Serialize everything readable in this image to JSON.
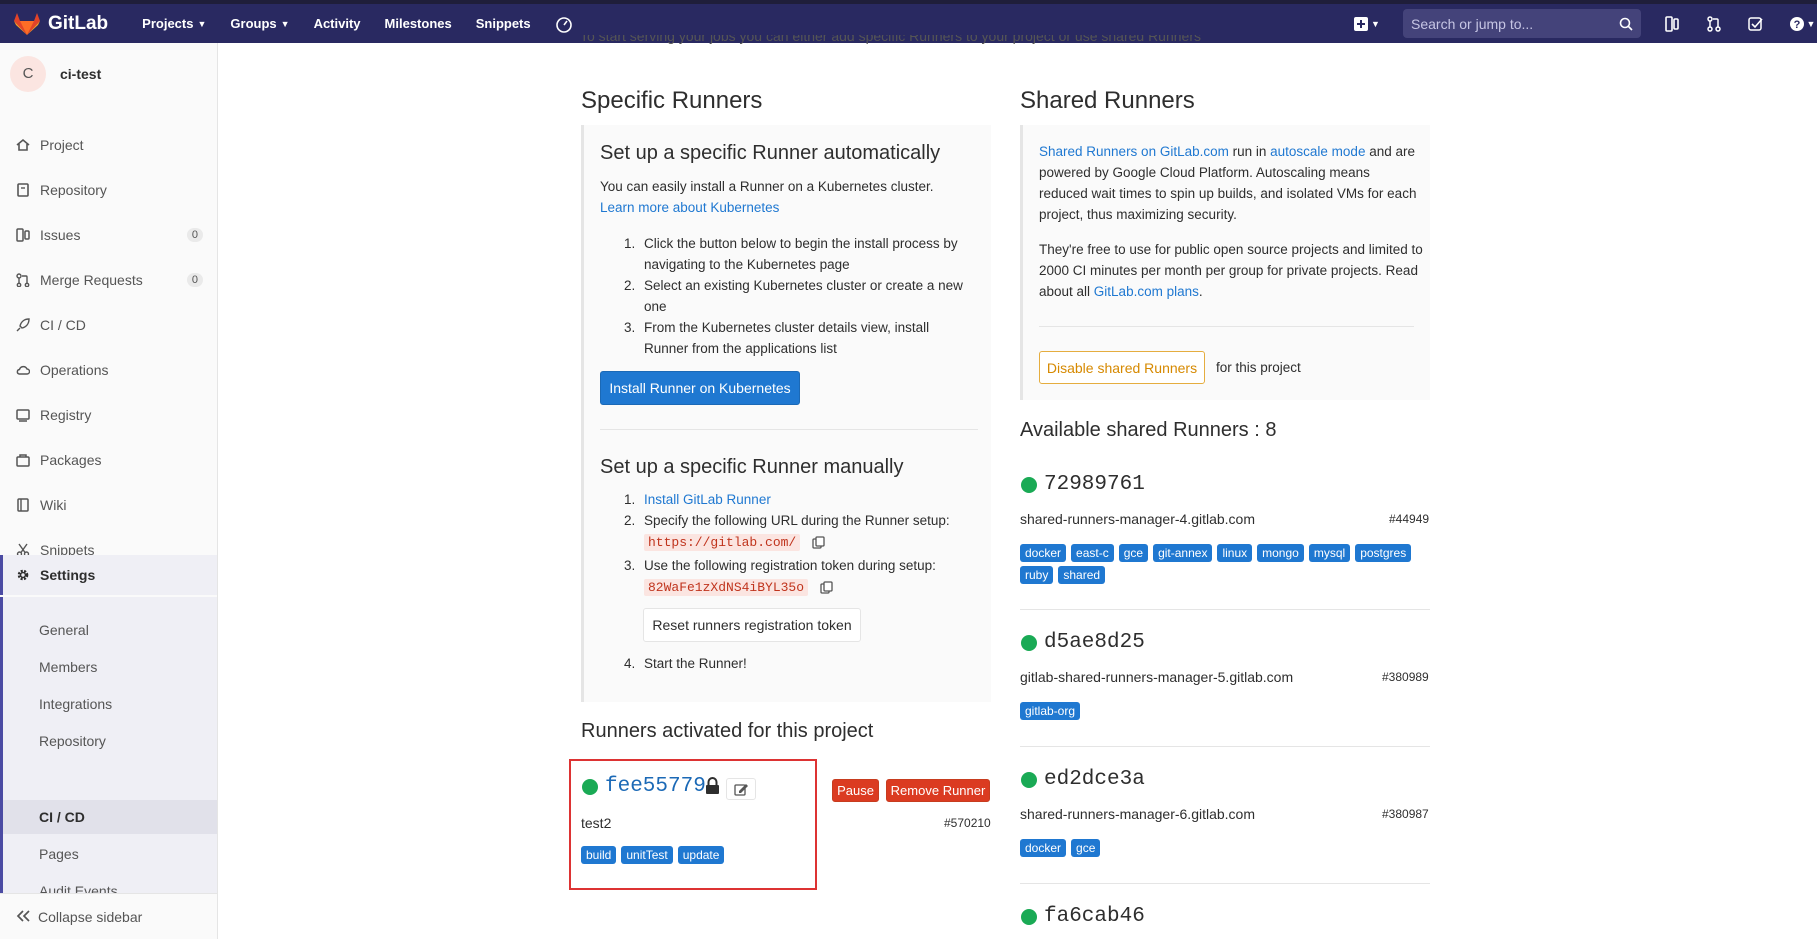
{
  "navbar": {
    "brand": "GitLab",
    "links": [
      "Projects",
      "Groups",
      "Activity",
      "Milestones",
      "Snippets"
    ],
    "search_placeholder": "Search or jump to..."
  },
  "sidebar": {
    "avatar_letter": "C",
    "project_name": "ci-test",
    "items": [
      {
        "label": "Project",
        "icon": "home-icon"
      },
      {
        "label": "Repository",
        "icon": "doc-icon"
      },
      {
        "label": "Issues",
        "icon": "issues-icon",
        "count": "0"
      },
      {
        "label": "Merge Requests",
        "icon": "merge-icon",
        "count": "0"
      },
      {
        "label": "CI / CD",
        "icon": "rocket-icon"
      },
      {
        "label": "Operations",
        "icon": "cloud-icon"
      },
      {
        "label": "Registry",
        "icon": "container-icon"
      },
      {
        "label": "Packages",
        "icon": "package-icon"
      },
      {
        "label": "Wiki",
        "icon": "book-icon"
      },
      {
        "label": "Snippets",
        "icon": "scissors-icon"
      },
      {
        "label": "Settings",
        "icon": "gear-icon"
      }
    ],
    "settings_sub": [
      "General",
      "Members",
      "Integrations",
      "Repository",
      "CI / CD",
      "Pages",
      "Audit Events"
    ],
    "collapse_label": "Collapse sidebar"
  },
  "main": {
    "cut_text": "To start serving your jobs you can either add specific Runners to your project or use shared Runners",
    "specific": {
      "title": "Specific Runners",
      "auto_head": "Set up a specific Runner automatically",
      "auto_text": "You can easily install a Runner on a Kubernetes cluster.",
      "auto_link": "Learn more about Kubernetes",
      "auto_steps": [
        "Click the button below to begin the install process by navigating to the Kubernetes page",
        "Select an existing Kubernetes cluster or create a new one",
        "From the Kubernetes cluster details view, install Runner from the applications list"
      ],
      "install_button": "Install Runner on Kubernetes",
      "manual_head": "Set up a specific Runner manually",
      "manual_step1_link": "Install GitLab Runner",
      "manual_step2": "Specify the following URL during the Runner setup:",
      "url": "https://gitlab.com/",
      "manual_step3": "Use the following registration token during setup:",
      "token": "82WaFe1zXdNS4iBYL35o",
      "reset_button": "Reset runners registration token",
      "manual_step4": "Start the Runner!"
    },
    "activated": {
      "title": "Runners activated for this project",
      "runner_id": "fee55779",
      "description": "test2",
      "number": "#570210",
      "tags": [
        "build",
        "unitTest",
        "update"
      ],
      "pause_button": "Pause",
      "remove_button": "Remove Runner"
    },
    "shared": {
      "title": "Shared Runners",
      "p1_link1": "Shared Runners on GitLab.com",
      "p1_t1": " run in ",
      "p1_link2": "autoscale mode",
      "p1_t2": " and are powered by Google Cloud Platform. Autoscaling means reduced wait times to spin up builds, and isolated VMs for each project, thus maximizing security.",
      "p2_t1": "They're free to use for public open source projects and limited to 2000 CI minutes per month per group for private projects. Read about all ",
      "p2_link": "GitLab.com plans",
      "p2_t2": ".",
      "disable_button": "Disable shared Runners",
      "disable_suffix": "for this project",
      "available_title": "Available shared Runners : 8",
      "runners": [
        {
          "id": "72989761",
          "desc": "shared-runners-manager-4.gitlab.com",
          "num": "#44949",
          "tags": [
            "docker",
            "east-c",
            "gce",
            "git-annex",
            "linux",
            "mongo",
            "mysql",
            "postgres",
            "ruby",
            "shared"
          ]
        },
        {
          "id": "d5ae8d25",
          "desc": "gitlab-shared-runners-manager-5.gitlab.com",
          "num": "#380989",
          "tags": [
            "gitlab-org"
          ]
        },
        {
          "id": "ed2dce3a",
          "desc": "shared-runners-manager-6.gitlab.com",
          "num": "#380987",
          "tags": [
            "docker",
            "gce"
          ]
        },
        {
          "id": "fa6cab46"
        }
      ]
    }
  },
  "colors": {
    "nav": "#292961",
    "primary": "#1f78d1",
    "success": "#1aaa55",
    "danger": "#db3b21",
    "warning": "#d68900"
  }
}
